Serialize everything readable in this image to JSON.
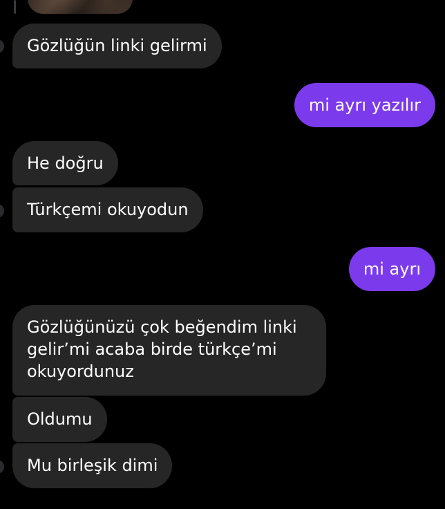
{
  "conversation": {
    "messages": [
      {
        "sender": "other",
        "text": "Gözlüğün linki gelirmi"
      },
      {
        "sender": "me",
        "text": "mi ayrı yazılır"
      },
      {
        "sender": "other",
        "text": "He doğru"
      },
      {
        "sender": "other",
        "text": "Türkçemi okuyodun"
      },
      {
        "sender": "me",
        "text": "mi ayrı"
      },
      {
        "sender": "other",
        "text": "Gözlüğünüzü çok beğendim linki gelir’mi acaba birde türkçe’mi okuyordunuz"
      },
      {
        "sender": "other",
        "text": "Oldumu"
      },
      {
        "sender": "other",
        "text": "Mu birleşik dimi"
      }
    ]
  },
  "colors": {
    "background": "#000000",
    "incoming_bubble": "#262626",
    "outgoing_bubble": "#7c3aed",
    "text": "#ffffff"
  }
}
